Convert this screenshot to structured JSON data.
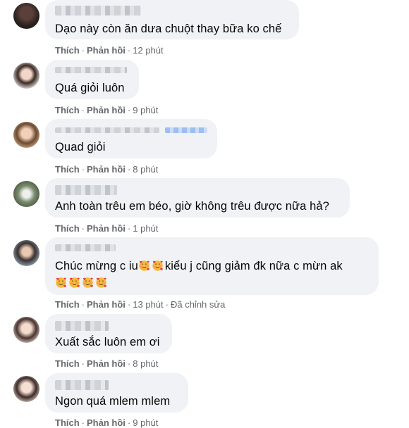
{
  "actions": {
    "like_label": "Thích",
    "reply_label": "Phản hồi",
    "separator": "·"
  },
  "comments": [
    {
      "text": "Dạo này còn ăn dưa chuột thay bữa ko chế",
      "time": "12 phút"
    },
    {
      "text": "Quá giỏi luôn",
      "time": "9 phút"
    },
    {
      "text": "Quad giỏi",
      "time": "8 phút"
    },
    {
      "text": "Anh toàn trêu em béo, giờ không trêu được nữa hả?",
      "time": "1 phút"
    },
    {
      "text_a": "Chúc mừng c iu",
      "text_b": "kiểu j cũng giảm đk nữa c mừn ak",
      "time": "13 phút",
      "edited": "Đã chỉnh sửa"
    },
    {
      "text": "Xuất sắc luôn em ơi",
      "time": "8 phút"
    },
    {
      "text": "Ngon quá mlem mlem",
      "time": "9 phút"
    }
  ],
  "colors": {
    "bubble": "#f0f2f5",
    "meta": "#65676b",
    "text": "#050505",
    "emoji_face": "#f7b93c"
  },
  "icons": [
    "smiling-face-with-hearts-emoji"
  ]
}
